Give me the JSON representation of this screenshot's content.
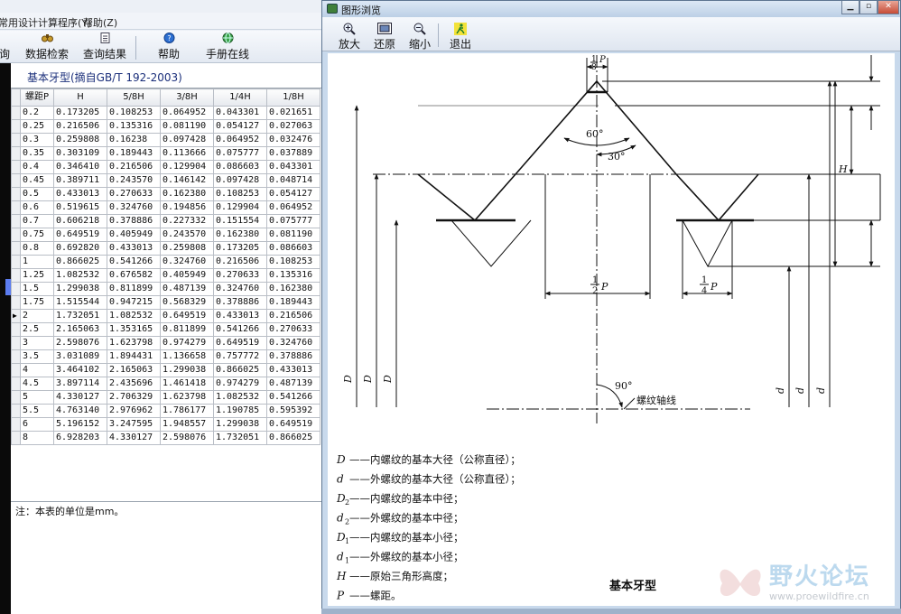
{
  "left_window": {
    "menu": [
      "常用设计计算程序(Y)",
      "帮助(Z)"
    ],
    "toolbar": {
      "query_partial": "询",
      "data_search": "数据检索",
      "query_result": "查询结果",
      "help": "帮助",
      "manual_online": "手册在线"
    },
    "table_title": "基本牙型(摘自GB/T 192-2003)",
    "columns": [
      "螺距P",
      "H",
      "5/8H",
      "3/8H",
      "1/4H",
      "1/8H"
    ],
    "rows": [
      [
        "0.2",
        "0.173205",
        "0.108253",
        "0.064952",
        "0.043301",
        "0.021651"
      ],
      [
        "0.25",
        "0.216506",
        "0.135316",
        "0.081190",
        "0.054127",
        "0.027063"
      ],
      [
        "0.3",
        "0.259808",
        "0.16238",
        "0.097428",
        "0.064952",
        "0.032476"
      ],
      [
        "0.35",
        "0.303109",
        "0.189443",
        "0.113666",
        "0.075777",
        "0.037889"
      ],
      [
        "0.4",
        "0.346410",
        "0.216506",
        "0.129904",
        "0.086603",
        "0.043301"
      ],
      [
        "0.45",
        "0.389711",
        "0.243570",
        "0.146142",
        "0.097428",
        "0.048714"
      ],
      [
        "0.5",
        "0.433013",
        "0.270633",
        "0.162380",
        "0.108253",
        "0.054127"
      ],
      [
        "0.6",
        "0.519615",
        "0.324760",
        "0.194856",
        "0.129904",
        "0.064952"
      ],
      [
        "0.7",
        "0.606218",
        "0.378886",
        "0.227332",
        "0.151554",
        "0.075777"
      ],
      [
        "0.75",
        "0.649519",
        "0.405949",
        "0.243570",
        "0.162380",
        "0.081190"
      ],
      [
        "0.8",
        "0.692820",
        "0.433013",
        "0.259808",
        "0.173205",
        "0.086603"
      ],
      [
        "1",
        "0.866025",
        "0.541266",
        "0.324760",
        "0.216506",
        "0.108253"
      ],
      [
        "1.25",
        "1.082532",
        "0.676582",
        "0.405949",
        "0.270633",
        "0.135316"
      ],
      [
        "1.5",
        "1.299038",
        "0.811899",
        "0.487139",
        "0.324760",
        "0.162380"
      ],
      [
        "1.75",
        "1.515544",
        "0.947215",
        "0.568329",
        "0.378886",
        "0.189443"
      ],
      [
        "2",
        "1.732051",
        "1.082532",
        "0.649519",
        "0.433013",
        "0.216506"
      ],
      [
        "2.5",
        "2.165063",
        "1.353165",
        "0.811899",
        "0.541266",
        "0.270633"
      ],
      [
        "3",
        "2.598076",
        "1.623798",
        "0.974279",
        "0.649519",
        "0.324760"
      ],
      [
        "3.5",
        "3.031089",
        "1.894431",
        "1.136658",
        "0.757772",
        "0.378886"
      ],
      [
        "4",
        "3.464102",
        "2.165063",
        "1.299038",
        "0.866025",
        "0.433013"
      ],
      [
        "4.5",
        "3.897114",
        "2.435696",
        "1.461418",
        "0.974279",
        "0.487139"
      ],
      [
        "5",
        "4.330127",
        "2.706329",
        "1.623798",
        "1.082532",
        "0.541266"
      ],
      [
        "5.5",
        "4.763140",
        "2.976962",
        "1.786177",
        "1.190785",
        "0.595392"
      ],
      [
        "6",
        "5.196152",
        "3.247595",
        "1.948557",
        "1.299038",
        "0.649519"
      ],
      [
        "8",
        "6.928203",
        "4.330127",
        "2.598076",
        "1.732051",
        "0.866025"
      ]
    ],
    "current_row": 15,
    "note": "注：本表的单位是mm。"
  },
  "right_window": {
    "title": "图形浏览",
    "toolbar": {
      "zoom_in": "放大",
      "restore": "还原",
      "zoom_out": "缩小",
      "exit": "退出"
    },
    "drawing": {
      "angle_60": "60°",
      "angle_30": "30°",
      "angle_90": "90°",
      "axis_label": "螺纹轴线",
      "half_p": "P",
      "quarter_p": "P",
      "top_p": "P",
      "dim_H": "H",
      "dim_D": "D",
      "dim_D2": "D",
      "dim_D1": "D",
      "dim_d1": "d",
      "dim_d2": "d",
      "dim_d": "d",
      "legend": [
        {
          "sym": "D",
          "sub": "",
          "text": "——内螺纹的基本大径（公称直径）；"
        },
        {
          "sym": "d",
          "sub": "",
          "text": "——外螺纹的基本大径（公称直径）；"
        },
        {
          "sym": "D",
          "sub": "2",
          "text": "——内螺纹的基本中径；"
        },
        {
          "sym": "d",
          "sub": "2",
          "text": "——外螺纹的基本中径；"
        },
        {
          "sym": "D",
          "sub": "1",
          "text": "——内螺纹的基本小径；"
        },
        {
          "sym": "d",
          "sub": "1",
          "text": "——外螺纹的基本小径；"
        },
        {
          "sym": "H",
          "sub": "",
          "text": "——原始三角形高度；"
        },
        {
          "sym": "P",
          "sub": "",
          "text": "——螺距。"
        }
      ],
      "caption": "基本牙型"
    }
  },
  "watermark": {
    "title": "野火论坛",
    "url": "www.proewildfire.cn"
  },
  "colors": {
    "accent_blue": "#1a2e7a",
    "title_bar": "#bcd0e6",
    "close_red": "#c64b36"
  }
}
